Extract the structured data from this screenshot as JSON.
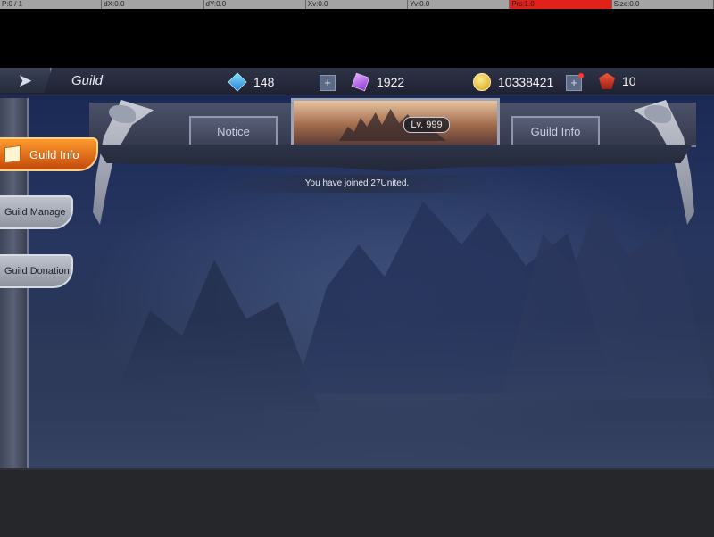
{
  "dev_overlay": {
    "cells": [
      {
        "label": "P:0 / 1",
        "hot": false
      },
      {
        "label": "dX:0.0",
        "hot": false
      },
      {
        "label": "dY:0.0",
        "hot": false
      },
      {
        "label": "Xv:0.0",
        "hot": false
      },
      {
        "label": "Yv:0.0",
        "hot": false
      },
      {
        "label": "Prs:1.0",
        "hot": true
      },
      {
        "label": "Size:0.0",
        "hot": false
      }
    ]
  },
  "hud": {
    "title": "Guild",
    "blue_gems": "148",
    "purple_gems": "1922",
    "gold": "10338421",
    "emblem_count": "10"
  },
  "banner": {
    "left_panel": "Notice",
    "right_panel": "Guild Info",
    "level": "Lv. 999"
  },
  "tabs": {
    "guild_info": "Guild Info",
    "guild_manage": "Guild Manage",
    "guild_donation": "Guild Donation"
  },
  "message": "You have joined 27United."
}
